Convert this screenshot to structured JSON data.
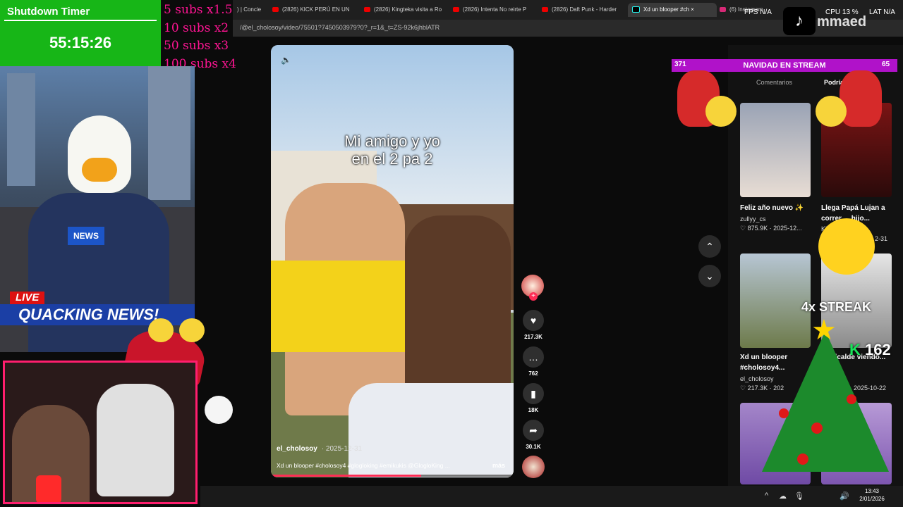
{
  "browser": {
    "tabs": [
      {
        "label": ") | Concie"
      },
      {
        "label": "(2826) KICK PERÚ EN UN"
      },
      {
        "label": "(2826) Kingteka visita a Ro"
      },
      {
        "label": "(2826) Intenta No reirte P"
      },
      {
        "label": "(2826) Daft Punk - Harder"
      },
      {
        "label": "Xd un blooper #ch"
      },
      {
        "label": "(6) Instagram"
      }
    ],
    "close_glyph": "×",
    "url": "/@el_cholosoy/video/75501?7450503979?0?_r=1&_t=ZS-92k6jhblATR"
  },
  "overlay": {
    "timer_title": "Shutdown Timer",
    "timer_value": "55:15:26",
    "subs_rules": [
      "5 subs x1.5",
      "10 subs x2",
      "50 subs x3",
      "100 subs x4"
    ],
    "live_label": "LIVE",
    "news_title": "QUACKING NEWS!",
    "news_mic_label": "NEWS",
    "fps_label": "FPS N/A",
    "cpu_label": "CPU 13 %",
    "lat_label": "LAT N/A",
    "channel_name": "mmaed",
    "navidad_left": "371",
    "navidad_text": "NAVIDAD EN STREAM",
    "navidad_right": "65",
    "streak_text": "4x STREAK",
    "k_count": "162",
    "k_label": "K",
    "star_glyph": "★",
    "tiktok_glyph": "♪"
  },
  "video": {
    "caption_line1": "Mi amigo y yo",
    "caption_line2": "en el 2 pa 2",
    "author": "el_cholosoy",
    "date": "· 2025-12-31",
    "description": "Xd un blooper #cholosoy4 #glogloking #emikukis @GlogloKing ...",
    "more_label": "más",
    "mute_glyph": "🔈",
    "progress": 0.62
  },
  "actions": {
    "plus_glyph": "+",
    "likes": "217.3K",
    "comments": "762",
    "saves": "18K",
    "shares": "30.1K",
    "like_glyph": "♥",
    "comment_glyph": "…",
    "save_glyph": "▮",
    "share_glyph": "➦"
  },
  "nav": {
    "up_glyph": "⌃",
    "down_glyph": "⌄"
  },
  "side": {
    "tab_comments": "Comentarios",
    "tab_related": "Podría gustarte",
    "items": [
      {
        "title": "Feliz año nuevo ✨",
        "user": "zullyy_cs",
        "meta": "♡ 875.9K · 2025-12..."
      },
      {
        "title": "Llega Papá Lujan a correr ... hijo...",
        "user": "Ki",
        "meta": "2-31"
      },
      {
        "title": "Xd un blooper #cholosoy4...",
        "user": "el_cholosoy",
        "meta": "♡ 217.3K · 202"
      },
      {
        "title": "alcalde viendo...",
        "user": "",
        "meta": "2025-10-22"
      }
    ]
  },
  "taskbar": {
    "time": "13:43",
    "date": "2/01/2026",
    "tray_icons": [
      "^",
      "☁",
      "🎙",
      "🔊"
    ]
  }
}
